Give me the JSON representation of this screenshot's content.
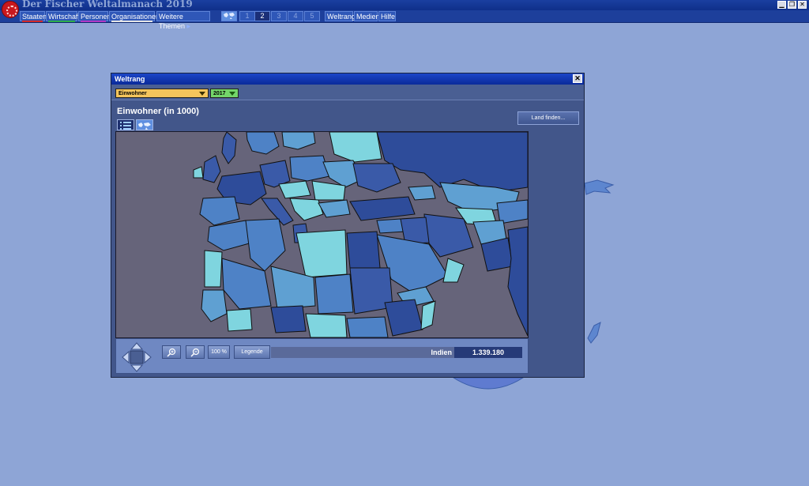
{
  "app": {
    "title": "Der Fischer Weltalmanach 2019"
  },
  "window_controls": {
    "minimize": "▁",
    "restore": "❐",
    "close": "✕"
  },
  "menu": {
    "items": [
      {
        "label": "Staaten",
        "color": "#d42a2a"
      },
      {
        "label": "Wirtschaft",
        "color": "#2eae4a"
      },
      {
        "label": "Personen",
        "color": "#b23ac6"
      },
      {
        "label": "Organisationen",
        "color": "#e6e6e6"
      },
      {
        "label": "Weitere Themen",
        "color": ""
      }
    ],
    "more_arrow": "▸",
    "tab_numbers": [
      "1",
      "2",
      "3",
      "4",
      "5"
    ],
    "right_items": [
      "Weltrang",
      "Medien",
      "Hilfe"
    ]
  },
  "dialog": {
    "title": "Weltrang",
    "close": "✕",
    "indicator_select": {
      "value": "Einwohner",
      "color": "#f4c55c"
    },
    "year_select": {
      "value": "2017",
      "color": "#74d66a"
    },
    "heading": "Einwohner (in 1000)",
    "land_button": "Land finden...",
    "view_icons": [
      "list-view-icon",
      "map-view-icon"
    ],
    "controls": {
      "zoom_100": "100 %",
      "legend": "Legende",
      "country": "Indien",
      "value": "1.339.180"
    }
  },
  "colors": {
    "background": "#8ea5d6",
    "map_sea": "#66647a",
    "shade_light": "#7fd5df",
    "shade_mid": "#4e82c6",
    "shade_dark": "#2e4c9a"
  }
}
